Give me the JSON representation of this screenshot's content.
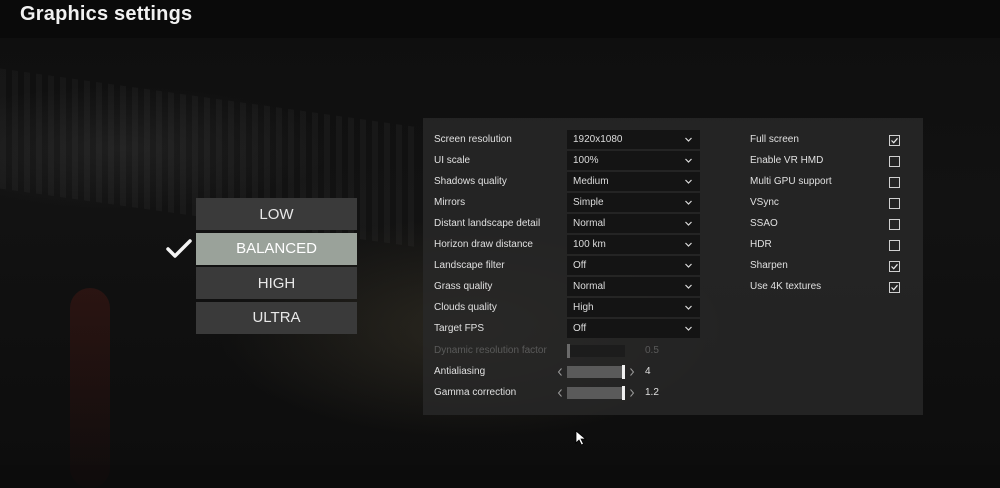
{
  "header": {
    "title": "Graphics settings"
  },
  "presets": {
    "items": [
      "LOW",
      "BALANCED",
      "HIGH",
      "ULTRA"
    ],
    "selected": "BALANCED"
  },
  "settings": {
    "dropdowns": [
      {
        "label": "Screen resolution",
        "value": "1920x1080"
      },
      {
        "label": "UI scale",
        "value": "100%"
      },
      {
        "label": "Shadows quality",
        "value": "Medium"
      },
      {
        "label": "Mirrors",
        "value": "Simple"
      },
      {
        "label": "Distant landscape detail",
        "value": "Normal"
      },
      {
        "label": "Horizon draw distance",
        "value": "100 km"
      },
      {
        "label": "Landscape filter",
        "value": "Off"
      },
      {
        "label": "Grass quality",
        "value": "Normal"
      },
      {
        "label": "Clouds quality",
        "value": "High"
      },
      {
        "label": "Target FPS",
        "value": "Off"
      }
    ],
    "sliders": [
      {
        "label": "Dynamic resolution factor",
        "value": "0.5",
        "disabled": true
      },
      {
        "label": "Antialiasing",
        "value": "4",
        "disabled": false
      },
      {
        "label": "Gamma correction",
        "value": "1.2",
        "disabled": false
      }
    ],
    "toggles": [
      {
        "label": "Full screen",
        "checked": true
      },
      {
        "label": "Enable VR HMD",
        "checked": false
      },
      {
        "label": "Multi GPU support",
        "checked": false
      },
      {
        "label": "VSync",
        "checked": false
      },
      {
        "label": "SSAO",
        "checked": false
      },
      {
        "label": "HDR",
        "checked": false
      },
      {
        "label": "Sharpen",
        "checked": true
      },
      {
        "label": "Use 4K textures",
        "checked": true
      }
    ]
  },
  "colors": {
    "accent_selected": "#9aa29a",
    "button_bg": "#3a3a3a",
    "panel_bg": "#282828"
  }
}
